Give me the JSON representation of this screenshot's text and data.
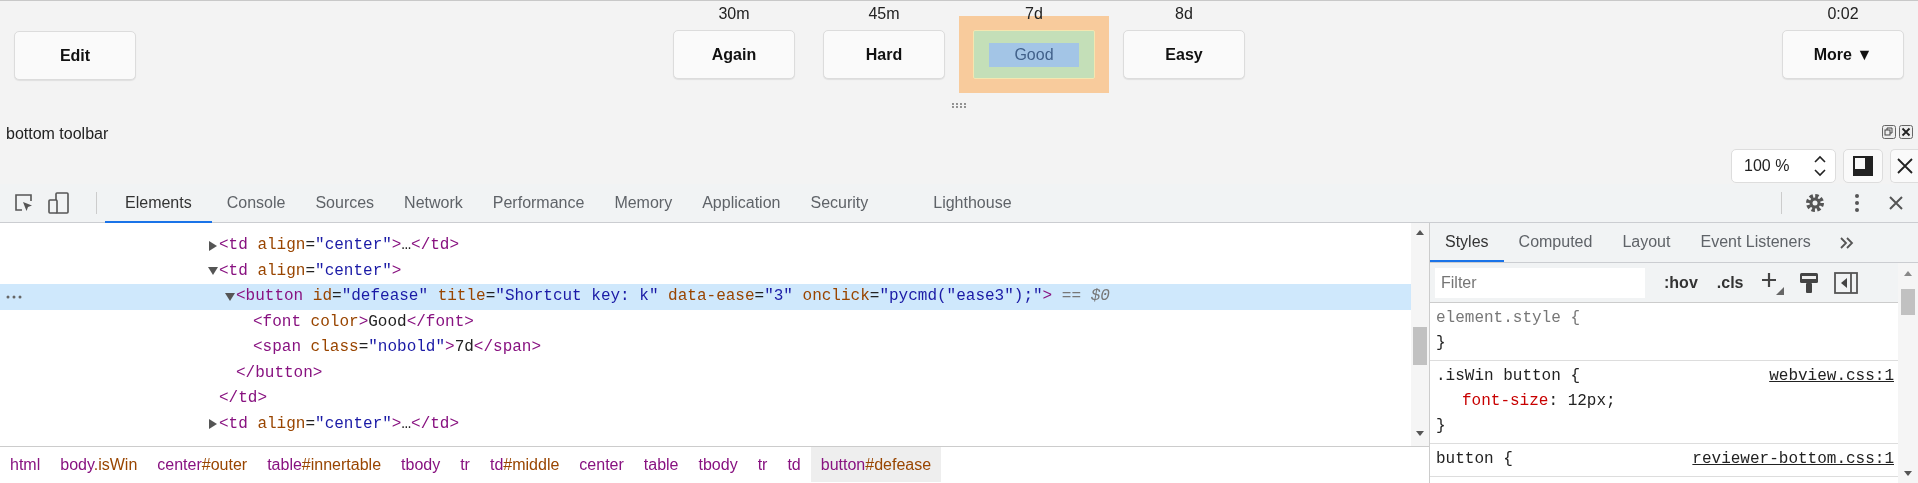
{
  "reviewer_bar": {
    "edit_button": "Edit",
    "answers": [
      {
        "interval": "30m",
        "label": "Again",
        "highlighted": false
      },
      {
        "interval": "45m",
        "label": "Hard",
        "highlighted": false
      },
      {
        "interval": "7d",
        "label": "Good",
        "highlighted": true
      },
      {
        "interval": "8d",
        "label": "Easy",
        "highlighted": false
      }
    ],
    "timer": "0:02",
    "more_button": "More ▼"
  },
  "page_label": "bottom toolbar",
  "zoom": {
    "value": "100 %"
  },
  "devtools": {
    "tabs": [
      {
        "label": "Elements",
        "selected": true
      },
      {
        "label": "Console",
        "selected": false
      },
      {
        "label": "Sources",
        "selected": false
      },
      {
        "label": "Network",
        "selected": false
      },
      {
        "label": "Performance",
        "selected": false
      },
      {
        "label": "Memory",
        "selected": false
      },
      {
        "label": "Application",
        "selected": false
      },
      {
        "label": "Security",
        "selected": false
      },
      {
        "label": "Lighthouse",
        "selected": false
      }
    ],
    "dom_tree": [
      {
        "selected": false,
        "expanded": false,
        "tokens": [
          {
            "kind": "tag",
            "text": "<td"
          },
          {
            "kind": "attr",
            "text": " align"
          },
          {
            "kind": "punct",
            "text": "="
          },
          {
            "kind": "value",
            "text": "\"center\""
          },
          {
            "kind": "tag",
            "text": ">"
          },
          {
            "kind": "text",
            "text": "…"
          },
          {
            "kind": "tag",
            "text": "</td>"
          }
        ]
      },
      {
        "selected": false,
        "expanded": true,
        "tokens": [
          {
            "kind": "tag",
            "text": "<td"
          },
          {
            "kind": "attr",
            "text": " align"
          },
          {
            "kind": "punct",
            "text": "="
          },
          {
            "kind": "value",
            "text": "\"center\""
          },
          {
            "kind": "tag",
            "text": ">"
          }
        ],
        "children": [
          {
            "selected": true,
            "expanded": true,
            "tokens": [
              {
                "kind": "tag",
                "text": "<button"
              },
              {
                "kind": "attr",
                "text": " id"
              },
              {
                "kind": "punct",
                "text": "="
              },
              {
                "kind": "value",
                "text": "\"defease\""
              },
              {
                "kind": "attr",
                "text": " title"
              },
              {
                "kind": "punct",
                "text": "="
              },
              {
                "kind": "value",
                "text": "\"Shortcut key: k\""
              },
              {
                "kind": "attr",
                "text": " data-ease"
              },
              {
                "kind": "punct",
                "text": "="
              },
              {
                "kind": "value",
                "text": "\"3\""
              },
              {
                "kind": "attr",
                "text": " onclick"
              },
              {
                "kind": "punct",
                "text": "="
              },
              {
                "kind": "value",
                "text": "\"pycmd(\"ease3\");\""
              },
              {
                "kind": "tag",
                "text": ">"
              },
              {
                "kind": "ref",
                "text": " == $0"
              }
            ],
            "children": [
              {
                "selected": false,
                "tokens": [
                  {
                    "kind": "tag",
                    "text": "<font"
                  },
                  {
                    "kind": "attr",
                    "text": " color"
                  },
                  {
                    "kind": "tag",
                    "text": ">"
                  },
                  {
                    "kind": "text",
                    "text": "Good"
                  },
                  {
                    "kind": "tag",
                    "text": "</font>"
                  }
                ]
              },
              {
                "selected": false,
                "tokens": [
                  {
                    "kind": "tag",
                    "text": "<span"
                  },
                  {
                    "kind": "attr",
                    "text": " class"
                  },
                  {
                    "kind": "punct",
                    "text": "="
                  },
                  {
                    "kind": "value",
                    "text": "\"nobold\""
                  },
                  {
                    "kind": "tag",
                    "text": ">"
                  },
                  {
                    "kind": "text",
                    "text": "7d"
                  },
                  {
                    "kind": "tag",
                    "text": "</span>"
                  }
                ]
              }
            ],
            "close_tokens": [
              {
                "kind": "tag",
                "text": "</button>"
              }
            ]
          }
        ],
        "close_tokens": [
          {
            "kind": "tag",
            "text": "</td>"
          }
        ]
      },
      {
        "selected": false,
        "expanded": false,
        "tokens": [
          {
            "kind": "tag",
            "text": "<td"
          },
          {
            "kind": "attr",
            "text": " align"
          },
          {
            "kind": "punct",
            "text": "="
          },
          {
            "kind": "value",
            "text": "\"center\""
          },
          {
            "kind": "tag",
            "text": ">"
          },
          {
            "kind": "text",
            "text": "…"
          },
          {
            "kind": "tag",
            "text": "</td>"
          }
        ]
      }
    ],
    "breadcrumbs": [
      {
        "tag": "html",
        "selected": false
      },
      {
        "tag": "body",
        "qualifier": ".isWin",
        "selected": false
      },
      {
        "tag": "center",
        "qualifier": "#outer",
        "selected": false
      },
      {
        "tag": "table",
        "qualifier": "#innertable",
        "selected": false
      },
      {
        "tag": "tbody",
        "selected": false
      },
      {
        "tag": "tr",
        "selected": false
      },
      {
        "tag": "td",
        "qualifier": "#middle",
        "selected": false
      },
      {
        "tag": "center",
        "selected": false
      },
      {
        "tag": "table",
        "selected": false
      },
      {
        "tag": "tbody",
        "selected": false
      },
      {
        "tag": "tr",
        "selected": false
      },
      {
        "tag": "td",
        "selected": false
      },
      {
        "tag": "button",
        "qualifier": "#defease",
        "selected": true
      }
    ],
    "styles": {
      "tabs": [
        {
          "label": "Styles",
          "selected": true
        },
        {
          "label": "Computed",
          "selected": false
        },
        {
          "label": "Layout",
          "selected": false
        },
        {
          "label": "Event Listeners",
          "selected": false
        }
      ],
      "filter": {
        "placeholder": "Filter"
      },
      "tool_buttons": [
        ":hov",
        ".cls"
      ],
      "rules": [
        {
          "kind": "inline",
          "selector": "element.style {",
          "close": "}"
        },
        {
          "kind": "rule",
          "selector": ".isWin button {",
          "source": "webview.css:1",
          "props": [
            {
              "name": "font-size",
              "rest": ": 12px;"
            }
          ],
          "close": "}"
        },
        {
          "kind": "rule",
          "selector": "button {",
          "source": "reviewer-bottom.css:1"
        }
      ]
    }
  }
}
